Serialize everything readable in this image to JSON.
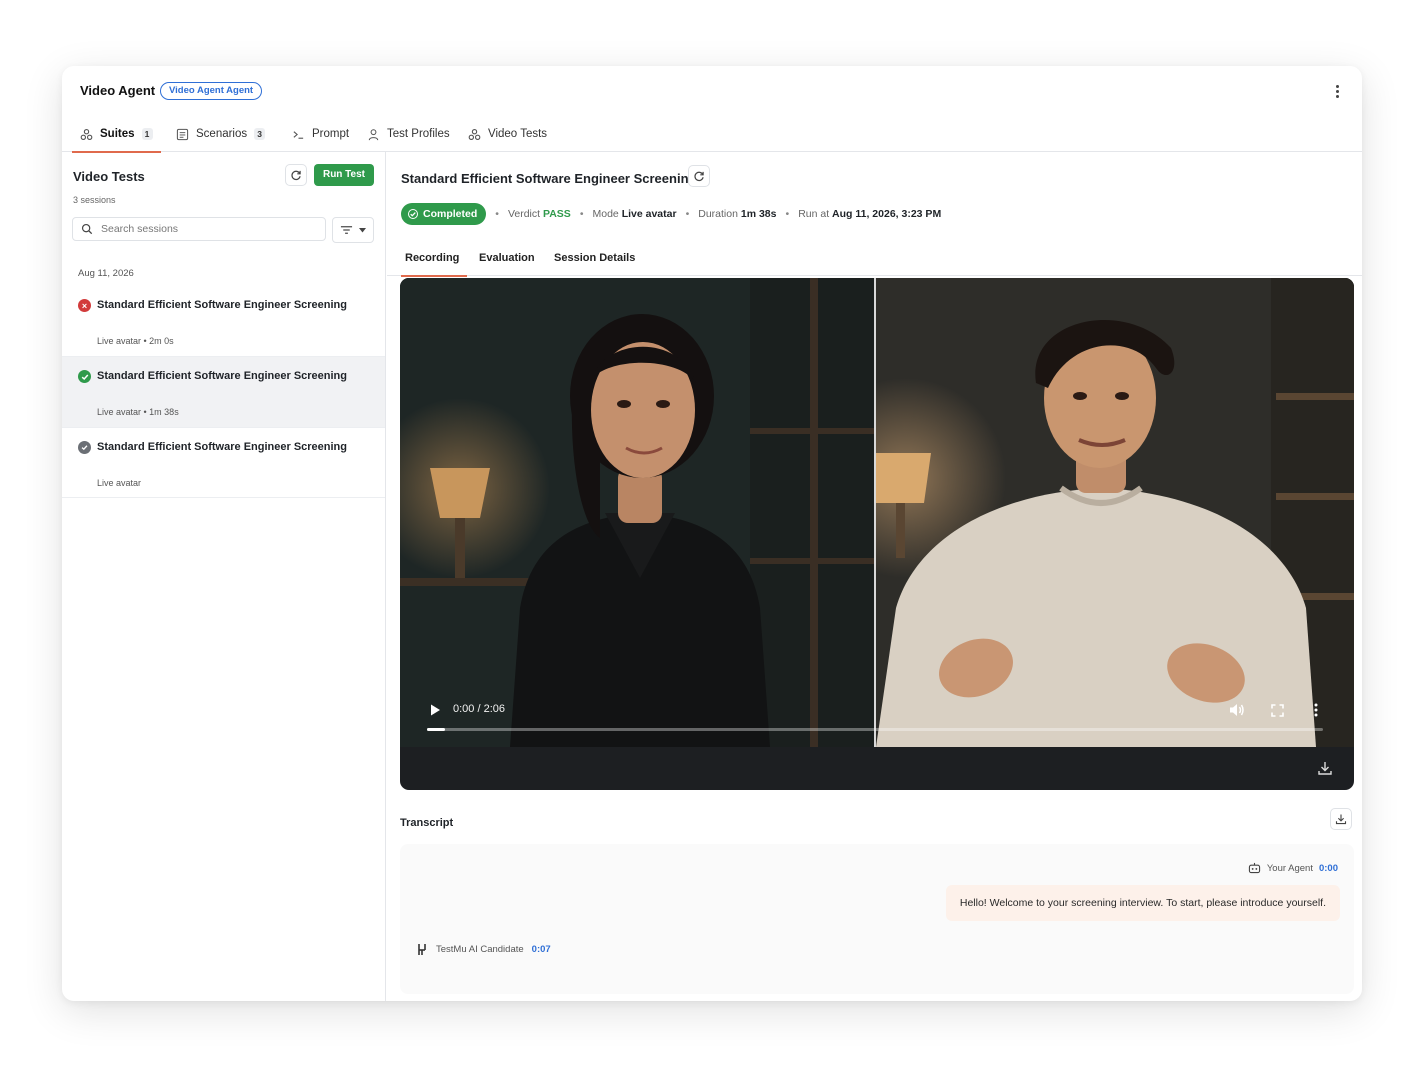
{
  "header": {
    "title": "Video Agent",
    "badge": "Video Agent Agent"
  },
  "nav": {
    "tabs": [
      {
        "label": "Suites",
        "count": "1",
        "icon": "suites-icon"
      },
      {
        "label": "Scenarios",
        "count": "3",
        "icon": "scenarios-icon"
      },
      {
        "label": "Prompt",
        "icon": "prompt-icon"
      },
      {
        "label": "Test Profiles",
        "icon": "profile-icon"
      },
      {
        "label": "Video Tests",
        "icon": "video-tests-icon"
      }
    ],
    "active": "Suites"
  },
  "sidebar": {
    "title": "Video Tests",
    "subtitle": "3 sessions",
    "run_button": "Run Test",
    "search_placeholder": "Search sessions",
    "date_group": "Aug 11, 2026",
    "sessions": [
      {
        "title": "Standard Efficient Software Engineer Screening",
        "meta": "Live avatar • 2m 0s",
        "status": "failed"
      },
      {
        "title": "Standard Efficient Software Engineer Screening",
        "meta": "Live avatar • 1m 38s",
        "status": "passed",
        "selected": true
      },
      {
        "title": "Standard Efficient Software Engineer Screening",
        "meta": "Live avatar",
        "status": "pending"
      }
    ]
  },
  "main": {
    "title": "Standard Efficient Software Engineer Screening",
    "status": "Completed",
    "verdict_label": "Verdict",
    "verdict_value": "PASS",
    "mode_label": "Mode",
    "mode_value": "Live avatar",
    "duration_label": "Duration",
    "duration_value": "1m 38s",
    "run_label": "Run at",
    "run_value": "Aug 11, 2026, 3:23 PM",
    "tabs": [
      "Recording",
      "Evaluation",
      "Session Details"
    ],
    "active_tab": "Recording"
  },
  "video": {
    "time": "0:00 / 2:06",
    "progress": 0.02
  },
  "transcript": {
    "title": "Transcript",
    "messages": [
      {
        "speaker": "Your Agent",
        "time": "0:00",
        "text": "Hello! Welcome to your screening interview. To start, please introduce yourself."
      },
      {
        "speaker": "TestMu AI Candidate",
        "time": "0:07"
      }
    ]
  },
  "colors": {
    "accent": "#e06a4c",
    "success": "#2f9a4b",
    "danger": "#d23b3b",
    "link": "#2f6fd6",
    "agent_bubble": "#fdf1ea"
  }
}
